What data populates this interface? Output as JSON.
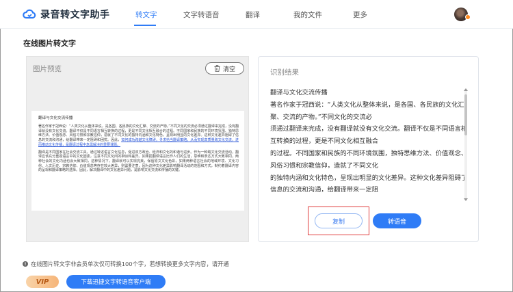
{
  "header": {
    "app_name": "录音转文字助手",
    "nav": [
      "转文字",
      "文字转语音",
      "翻译",
      "我的文件",
      "更多"
    ],
    "active_index": 0
  },
  "page": {
    "title": "在线图片转文字"
  },
  "preview": {
    "title": "图片预览",
    "clear_label": "清空",
    "doc": {
      "title": "翻译与文化交流传播",
      "para1_a": "著名作家于冠西说：“人类文化从整体来说，是各国、各民族的文化汇聚、交流的产物。”不同文化的交流必须通过翻译来完成，没有翻译就没有文化交流。翻译不仅是不同语言相互转换的过程，更是不同文化相互融合的过程。不同国家和民族的不同环境氛围、独特思维方法、价值观念、风俗习惯和宗教信仰，造就了不同文化的独特内涵和文化特色，呈现出明显的文化差异。这种文化差异阻碍了信息的交流和沟通，给翻译带来一定阻碍和困扰。因此，",
      "para1_hl": "如何成功跨越文化障碍，寻求恰当翻译策略，从而实现高质量跨文化交流，进而推动文化传播，是翻译过程中急需解决的重要课题。",
      "para2": "翻译是不同国家在社会交流工具，通过转述语言文化信息，促进双方政治、经济和文化的和谐与进步。作为一种跨文化交流活动，翻译应该充分重视语言中的文化因素，注意不同文化间的相似和差异。如果把翻译语言比作人们的生活，思维和表达方式大致相同，两种社会的文化内涵也会大致相同，这种情况下，翻译就可以实现完美，保留原文文化色彩。如果两种语言社会的地域环境、文化习俗、人文历史、宗教信仰、价值观念等存在较大差异，则需要注意，因为这种文化差异影响翻译活动的范围和方式，制约着翻译内容的呈现和翻译策略的选择。因此，解决翻译中的文化差异问题，是影响文化交流和传播的关键。"
    }
  },
  "result": {
    "title": "识别结果",
    "lines": [
      "翻译与文化交流传播",
      "著名作家于冠西说：“人类文化从整体来说，是各国、各民族的文化汇聚、交流的产物。”不同文化的交流必",
      "须通过翻译来完成，没有翻译就没有文化交流。翻译不仅是不同语言相互转换的过程，更是不同文化相互融合",
      "的过程。不同国家和民族的不同环境氛围，独特思维方法、价值观念、风俗习惯和宗教信仰，造就了不同文化",
      "的独特内涵和文化特色，呈现出明显的文化差异。这种文化差异阻碍了信息的交流和沟通，给翻译带来一定阻"
    ],
    "copy_label": "复制",
    "speech_label": "转语音"
  },
  "footer": {
    "notice": "在线图片转文字非会员单次仅可转换100个字，若想转换更多文字内容，请开通",
    "vip_label": "VIP",
    "download_label": "下载迅捷文字转语音客户端"
  },
  "colors": {
    "accent": "#2f7cf6",
    "highlight_box": "#e03a3a"
  }
}
